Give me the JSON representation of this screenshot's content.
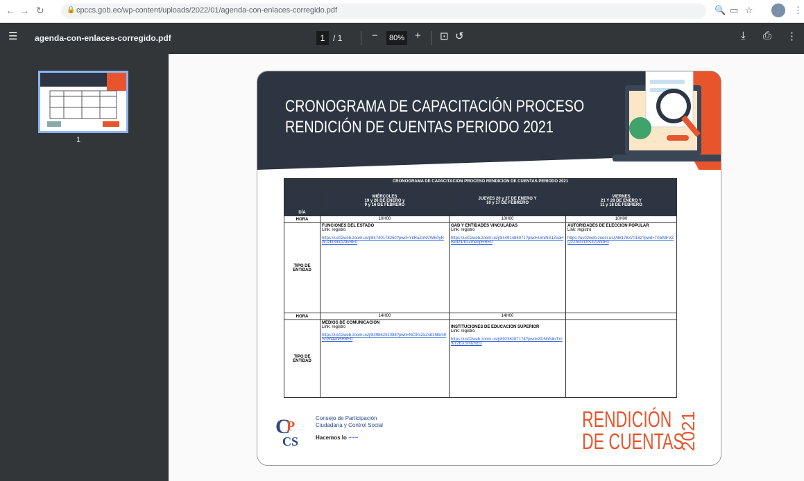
{
  "browser": {
    "url": "cpccs.gob.ec/wp-content/uploads/2022/01/agenda-con-enlaces-corregido.pdf"
  },
  "pdf_toolbar": {
    "filename": "agenda-con-enlaces-corregido.pdf",
    "page_current": "1",
    "page_total": "/ 1",
    "zoom": "80%"
  },
  "sidebar": {
    "thumb_label": "1"
  },
  "document": {
    "title_line1": "CRONOGRAMA DE CAPACITACIÓN PROCESO",
    "title_line2": "RENDICIÓN DE CUENTAS PERIODO 2021",
    "table_caption": "CRONOGRAMA DE CAPACITACIÓN PROCESO RENDICIÓN DE CUENTAS PERIODO 2021",
    "col_dia": "DÍA",
    "days": [
      {
        "line1": "MIÉRCOLES",
        "line2": "19 y 26 DE ENERO y",
        "line3": "9 y 16 DE FEBRERO"
      },
      {
        "line1": "",
        "line2": "JUEVES 20 y 27 DE ENERO Y",
        "line3": "10 y 17 DE FEBRERO"
      },
      {
        "line1": "VIERNES",
        "line2": "21 Y 28 DE ENERO Y",
        "line3": "11 y 18 DE FEBRERO"
      }
    ],
    "hora_label": "HORA",
    "tipo_label": "TIPO DE ENTIDAD",
    "row1_hora": [
      "10H00",
      "10H00",
      "10H00"
    ],
    "row1": [
      {
        "entidad": "FUNCIONES DEL ESTADO",
        "link_label": "Link: registro",
        "link": "https://us02web.zoom.us/j/84740178250?pwd=YkRaZnNVWE0yRWJzb09nQ2dvRE0"
      },
      {
        "entidad": "GAD Y ENTIDADES VINCULADAS",
        "link_label": "Link: registro",
        "link": "https://us02web.zoom.us/j/84491488071?pwd=UmlNS1ZxaHBxdzlPb2ZmenpHRE0"
      },
      {
        "entidad": "AUTORIDADES DE ELECCIÓN POPULAR",
        "link_label": "Link: registro",
        "link": "https://us02web.zoom.us/j/88176370182?pwd=T0lxMFVZQ2ZhcG1XSXZPd0E0"
      }
    ],
    "row2_hora": [
      "14H00",
      "14H00",
      ""
    ],
    "row2": [
      {
        "entidad": "MEDIOS DE COMUNICACIÓN",
        "link_label": "Link: registro",
        "link": "https://us02web.zoom.us/j/83986231088?pwd=NC9mZkZsb3hlbm9ScWlaenRHRE0"
      },
      {
        "entidad": "INSTITUCIONES DE EDUCACIÓN SUPERIOR",
        "link_label": "Link: registro",
        "link": "https://us02web.zoom.us/j/89238287174?pwd=ZDNhNlkrTm9jYzBXSmlzRE0"
      },
      {
        "entidad": "",
        "link_label": "",
        "link": ""
      }
    ],
    "logo_line1": "Consejo de Participación",
    "logo_line2": "Ciudadana y Control Social",
    "logo_slogan": "Hacemos lo",
    "rend_line1": "RENDICIÓN",
    "rend_line2": "DE CUENTAS",
    "rend_year": "2021"
  },
  "colors": {
    "header_dark": "#2c3541",
    "accent_orange": "#e8552d",
    "pdf_toolbar": "#323639"
  }
}
